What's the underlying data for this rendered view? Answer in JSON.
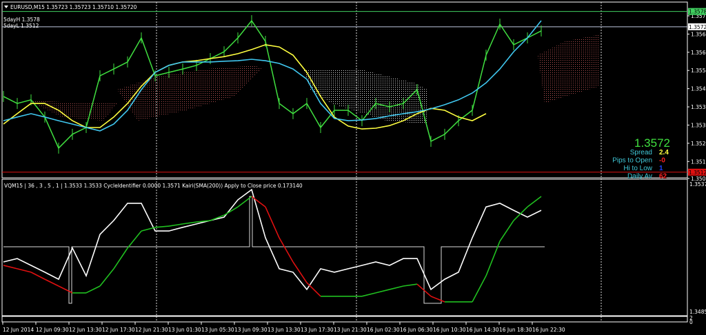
{
  "header": {
    "symbol_line": "EURUSD,M15  1.35723 1.35723 1.35710 1.35720",
    "five_day_high": "5dayH 1.3578",
    "five_day_low": "5dayL 1.3512"
  },
  "indicator_header": "VQM15 | 36 , 3 , 5 , 1  |  1.3533 1.3533  CycleIdentifier 0.0000 1.3571  Kairi(SMA(200)) Apply to Close price 0.173140",
  "info_panel": {
    "price": "1.3572",
    "rows": [
      {
        "label": "Spread",
        "value": "2.4",
        "color": "#ffff40"
      },
      {
        "label": "Pips to Open",
        "value": "-0",
        "color": "#ff2020"
      },
      {
        "label": "Hi to Low",
        "value": "1",
        "color": "#2040ff"
      },
      {
        "label": "Daily Av",
        "value": "62",
        "color": "#ff2020"
      }
    ]
  },
  "price_axis": {
    "labels": [
      "1.35765",
      "1.35690",
      "1.35615",
      "1.35540",
      "1.35465",
      "1.35390",
      "1.35315",
      "1.35240",
      "1.35165",
      "1.35095"
    ],
    "high_marker": "1.35783",
    "current_marker": "1.35720",
    "low_marker": "1.35121"
  },
  "indicator_axis": {
    "top": "1.3537",
    "bottom": "1.3485"
  },
  "third_axis": {
    "top": "2",
    "bottom": "0"
  },
  "time_axis": [
    "12 Jun 2014",
    "12 Jun 09:30",
    "12 Jun 13:30",
    "12 Jun 17:30",
    "12 Jun 21:30",
    "13 Jun 01:30",
    "13 Jun 05:30",
    "13 Jun 09:30",
    "13 Jun 13:30",
    "13 Jun 17:30",
    "13 Jun 21:30",
    "16 Jun 02:30",
    "16 Jun 06:30",
    "16 Jun 10:30",
    "16 Jun 14:30",
    "16 Jun 18:30",
    "16 Jun 22:30"
  ],
  "colors": {
    "price": "#40e040",
    "ma_yellow": "#ffff40",
    "ma_cyan": "#40c8f0",
    "osc": "#ffffff",
    "signal_up": "#20c020",
    "signal_down": "#e01010",
    "high_line": "#40d060",
    "low_line": "#e01010",
    "current_line": "#c0c8e0"
  },
  "chart_data": [
    {
      "type": "line",
      "title": "EURUSD,M15",
      "units": "pips above 1.3500",
      "base_price": 1.35,
      "ylim": [
        -3,
        78
      ],
      "levels": {
        "five_day_high": 1.35783,
        "current": 1.3572,
        "five_day_low": 1.35121
      },
      "series": [
        {
          "name": "price",
          "values": [
            43.3,
            40.4,
            41.9,
            34.8,
            22.0,
            27.7,
            30.5,
            51.8,
            54.6,
            57.5,
            67.4,
            51.8,
            53.2,
            54.6,
            56.1,
            58.9,
            61.7,
            67.4,
            74.5,
            66.0,
            40.4,
            36.2,
            40.4,
            30.5,
            37.6,
            37.6,
            33.3,
            40.4,
            39.0,
            40.4,
            46.1,
            24.8,
            27.7,
            33.3,
            37.6,
            60.3,
            73.1,
            64.6,
            67.4,
            70.3
          ]
        },
        {
          "name": "ma_yellow",
          "values": [
            31.9,
            36.2,
            40.4,
            40.4,
            37.6,
            33.3,
            30.5,
            30.5,
            34.8,
            40.4,
            47.5,
            53.2,
            56.1,
            57.5,
            58.0,
            58.9,
            59.7,
            60.9,
            62.6,
            64.6,
            63.7,
            60.3,
            53.2,
            43.3,
            34.8,
            31.1,
            29.9,
            30.2,
            31.3,
            33.3,
            36.2,
            38.4,
            37.6,
            34.8,
            33.3,
            36.2
          ]
        },
        {
          "name": "ma_cyan",
          "values": [
            33.3,
            34.8,
            36.2,
            34.8,
            33.3,
            31.9,
            30.5,
            29.1,
            31.9,
            37.6,
            46.1,
            53.2,
            56.1,
            57.5,
            57.5,
            57.5,
            57.8,
            58.0,
            58.6,
            58.0,
            56.9,
            54.6,
            50.4,
            40.4,
            34.2,
            33.3,
            33.6,
            34.2,
            35.3,
            36.2,
            37.0,
            38.2,
            39.9,
            41.9,
            44.7,
            48.9,
            54.6,
            61.7,
            67.4,
            74.5
          ]
        }
      ]
    },
    {
      "type": "line",
      "title": "VQM15",
      "units": "pips above 1.3485",
      "ylim": [
        0,
        52
      ],
      "series": [
        {
          "name": "vqm",
          "values": [
            20.3,
            21.7,
            18.9,
            16.1,
            13.2,
            26.0,
            14.6,
            31.6,
            37.3,
            44.4,
            44.4,
            33.0,
            33.0,
            34.5,
            35.9,
            37.3,
            38.7,
            45.8,
            50.0,
            30.2,
            17.5,
            16.1,
            9.0,
            17.5,
            16.1,
            17.5,
            18.9,
            20.3,
            18.9,
            21.7,
            21.7,
            9.0,
            13.2,
            16.1,
            30.2,
            42.9,
            44.4,
            41.5,
            38.7,
            41.5
          ]
        },
        {
          "name": "signal",
          "values": [
            18.9,
            17.5,
            16.1,
            13.2,
            10.4,
            7.6,
            7.6,
            10.4,
            17.5,
            26.0,
            33.0,
            34.5,
            35.0,
            35.9,
            36.7,
            37.3,
            39.5,
            42.9,
            47.2,
            42.9,
            30.2,
            20.3,
            11.8,
            6.2,
            6.2,
            6.2,
            6.2,
            7.6,
            9.0,
            10.4,
            11.2,
            6.2,
            3.9,
            3.9,
            3.9,
            14.6,
            28.8,
            37.3,
            42.9,
            47.2
          ]
        }
      ]
    }
  ]
}
